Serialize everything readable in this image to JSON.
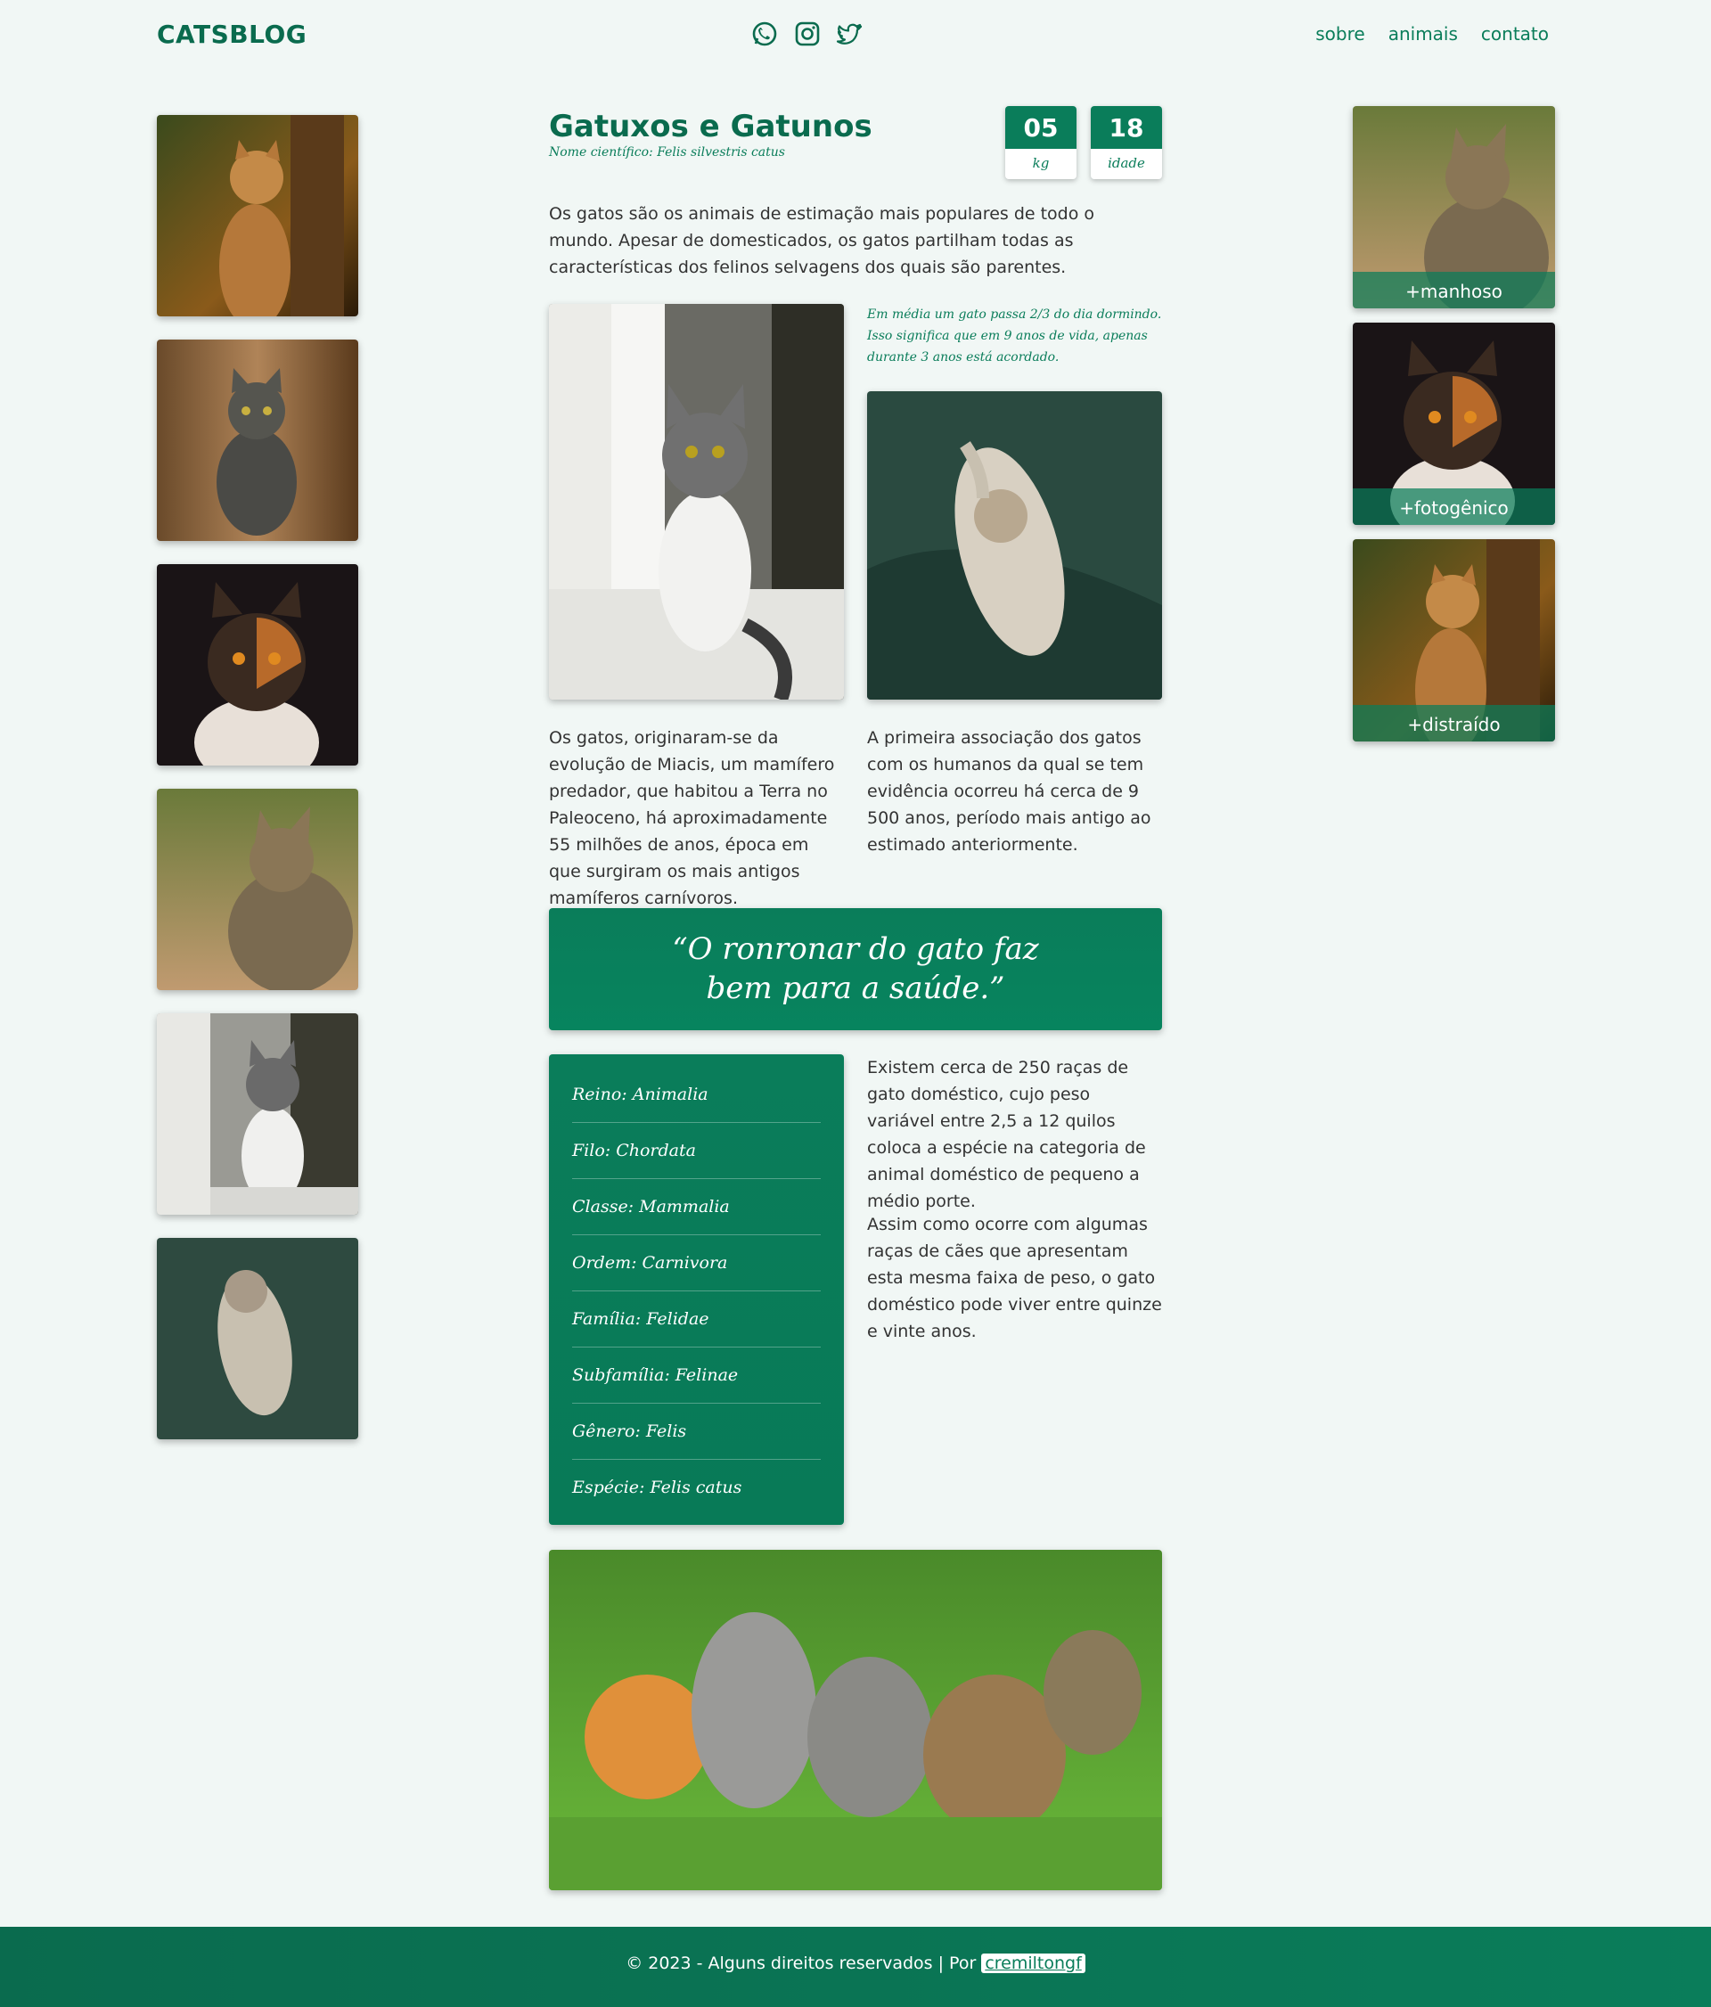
{
  "header": {
    "logo": "CATSBLOG",
    "social": [
      "whatsapp-icon",
      "instagram-icon",
      "twitter-icon"
    ],
    "nav": [
      "sobre",
      "animais",
      "contato"
    ]
  },
  "article": {
    "title": "Gatuxos e Gatunos",
    "subtitle": "Nome científico: Felis silvestris catus",
    "stats": [
      {
        "value": "05",
        "label": "kg"
      },
      {
        "value": "18",
        "label": "idade"
      }
    ],
    "intro": "Os gatos são os animais de estimação mais populares de todo o mundo. Apesar de domesticados, os gatos partilham todas as características dos felinos selvagens dos quais são parentes.",
    "note": "Em média um gato passa 2/3 do dia dormindo. Isso significa que em 9 anos de vida, apenas durante 3 anos está acordado.",
    "col_left": "Os gatos, originaram-se da evolução de Miacis, um mamífero predador, que habitou a Terra no Paleoceno, há aproximadamente 55 milhões de anos, época em que surgiram os mais antigos mamíferos carnívoros.",
    "col_right": "A primeira associação dos gatos com os humanos da qual se tem evidência ocorreu há cerca de 9 500 anos, período mais antigo ao estimado anteriormente.",
    "quote_line1": "“O ronronar do gato faz",
    "quote_line2": "bem para a saúde.”",
    "taxonomy": [
      "Reino: Animalia",
      "Filo: Chordata",
      "Classe: Mammalia",
      "Ordem: Carnivora",
      "Família: Felidae",
      "Subfamília: Felinae",
      "Gênero: Felis",
      "Espécie: Felis catus"
    ],
    "para1": "Existem cerca de 250 raças de gato doméstico, cujo peso variável entre 2,5 a 12 quilos coloca a espécie na categoria de animal doméstico de pequeno a médio porte.",
    "para2": "Assim como ocorre com algumas raças de cães que apresentam esta mesma faixa de peso, o gato doméstico pode viver entre quinze e vinte anos."
  },
  "right_gallery": [
    "+manhoso",
    "+fotogênico",
    "+distraído"
  ],
  "footer": {
    "text": "© 2023 - Alguns direitos reservados | Por",
    "link": "cremiltongf"
  },
  "colors": {
    "accent": "#0a7d5a",
    "background": "#f1f7f5"
  }
}
